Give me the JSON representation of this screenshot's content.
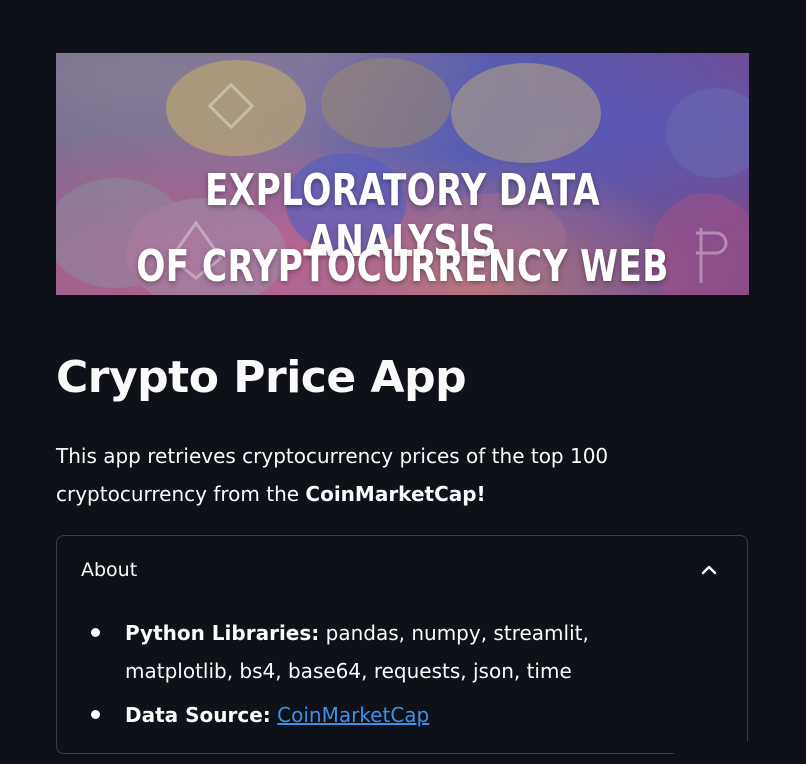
{
  "banner": {
    "line1": "EXPLORATORY DATA ANALYSIS",
    "line2": "OF CRYPTOCURRENCY WEB APP"
  },
  "title": "Crypto Price App",
  "intro": {
    "text_before": "This app retrieves cryptocurrency prices of the top 100 cryptocurrency from the ",
    "bold": "CoinMarketCap!"
  },
  "expander": {
    "label": "About",
    "items": [
      {
        "label": "Python Libraries:",
        "value": " pandas, numpy, streamlit, matplotlib, bs4, base64, requests, json, time"
      },
      {
        "label": "Data Source:",
        "link": "CoinMarketCap"
      }
    ]
  },
  "colors": {
    "background": "#0e1117",
    "text": "#fafafa",
    "link": "#3d8fe8",
    "border": "#3b3f4a"
  }
}
